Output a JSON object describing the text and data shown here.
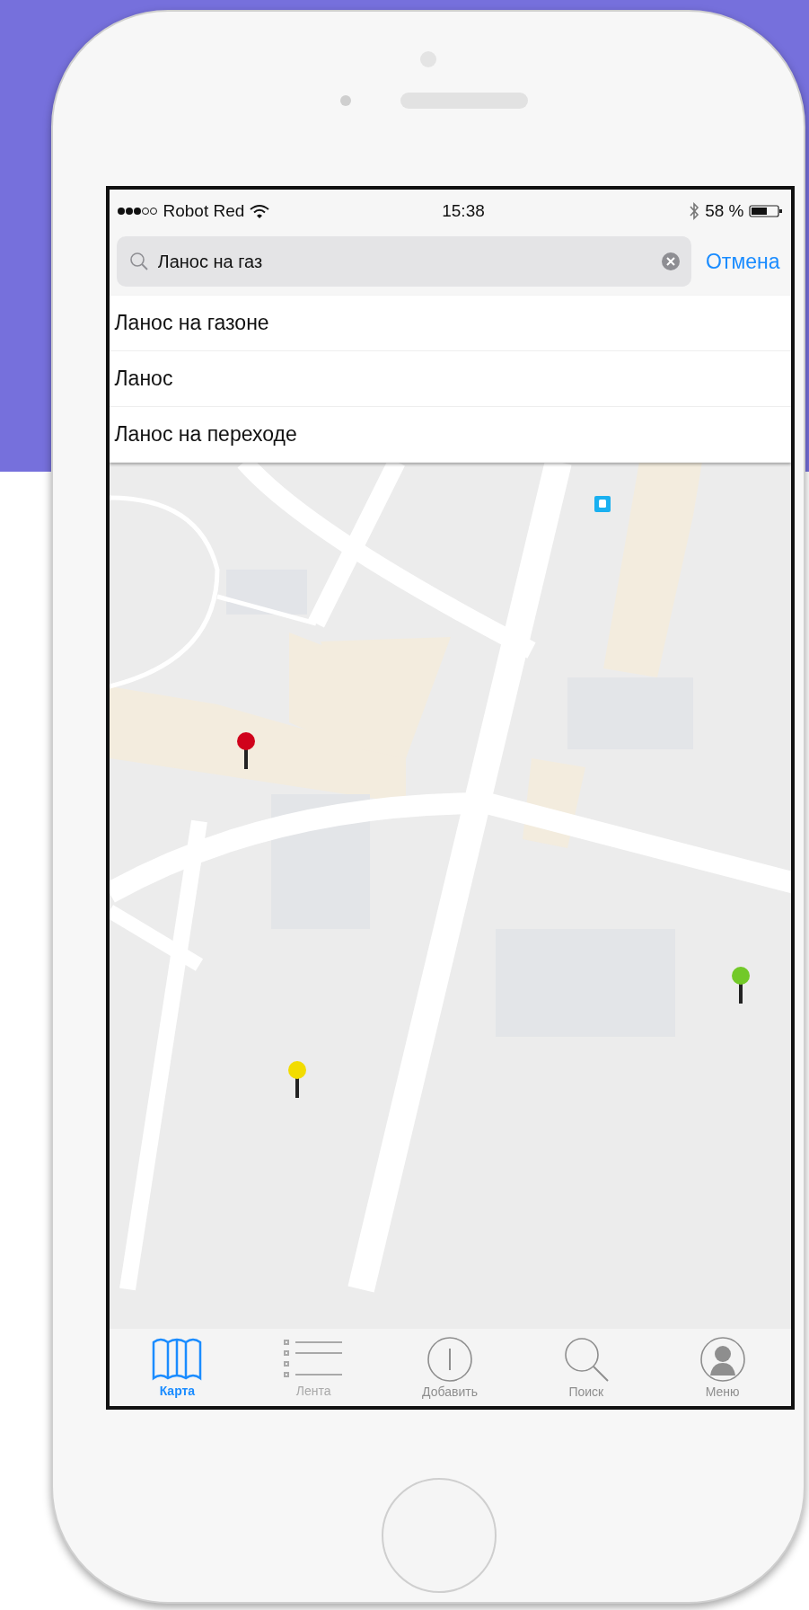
{
  "status_bar": {
    "carrier": "Robot Red",
    "time": "15:38",
    "battery": "58 %"
  },
  "search": {
    "value": "Ланос на газ",
    "cancel": "Отмена"
  },
  "suggestions": [
    "Ланос на газоне",
    "Ланос",
    "Ланос на переходе"
  ],
  "map": {
    "pins": [
      {
        "color": "#d0021b"
      },
      {
        "color": "#f2dc00"
      },
      {
        "color": "#72c928"
      }
    ]
  },
  "tabs": [
    {
      "kind": "map",
      "label": "Карта",
      "selected": true,
      "disabled": false
    },
    {
      "kind": "list",
      "label": "Лента",
      "selected": false,
      "disabled": true
    },
    {
      "kind": "add",
      "label": "Добавить",
      "selected": false,
      "disabled": false
    },
    {
      "kind": "search",
      "label": "Поиск",
      "selected": false,
      "disabled": false
    },
    {
      "kind": "profile",
      "label": "Меню",
      "selected": false,
      "disabled": false
    }
  ]
}
